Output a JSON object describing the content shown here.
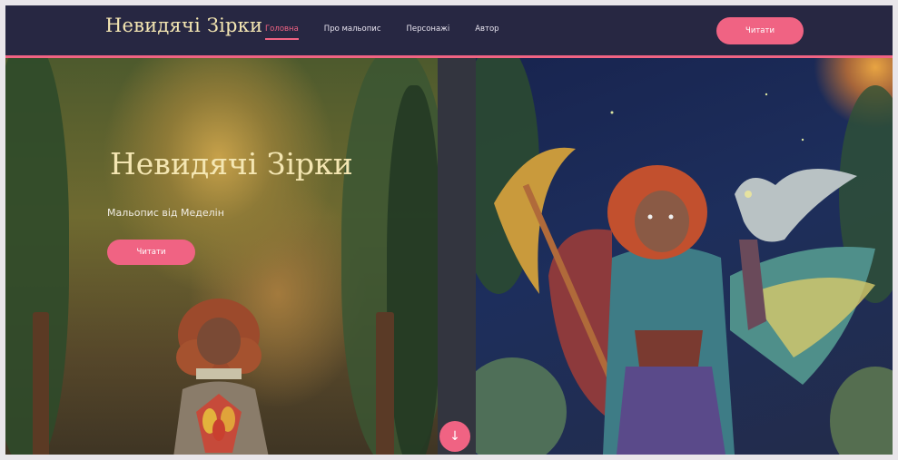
{
  "header": {
    "logo": "Невидячі Зірки",
    "nav": [
      {
        "label": "Головна",
        "active": true
      },
      {
        "label": "Про мальопис",
        "active": false
      },
      {
        "label": "Персонажі",
        "active": false
      },
      {
        "label": "Автор",
        "active": false
      }
    ],
    "cta_label": "Читати"
  },
  "hero": {
    "title": "Невидячі Зірки",
    "subtitle": "Мальопис від Меделін",
    "cta_label": "Читати",
    "scroll_icon": "↓"
  },
  "colors": {
    "accent": "#f06383",
    "navbar": "#272742",
    "title": "#f4e6b2"
  }
}
